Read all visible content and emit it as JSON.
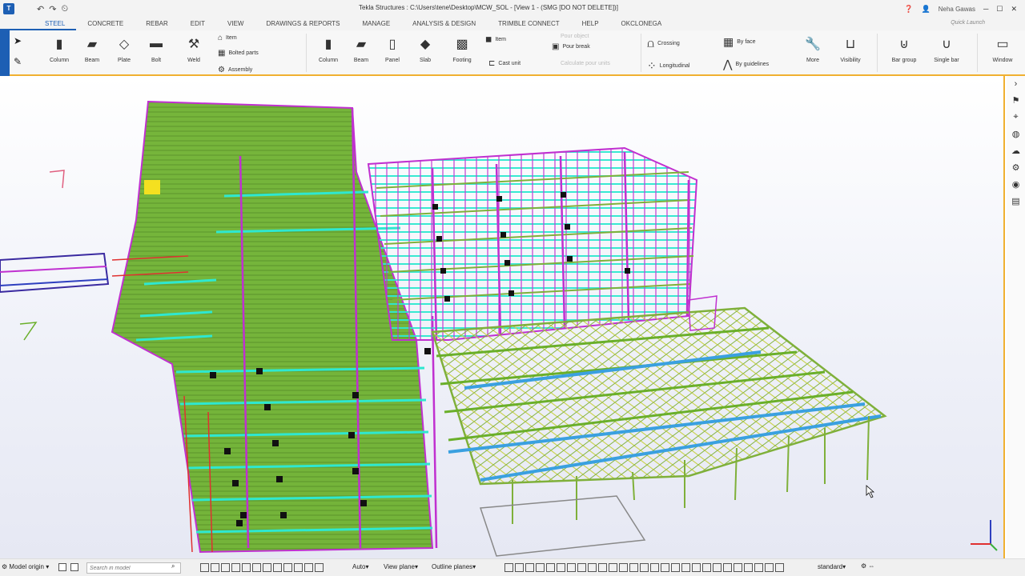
{
  "window": {
    "title": "Tekla Structures : C:\\Users\\tene\\Desktop\\MCW_SOL  - [View 1 - (SMG [DO NOT DELETE])]",
    "user": "Neha Gawas",
    "icons": [
      "undo-icon",
      "redo-icon",
      "clock-icon",
      "help-icon",
      "user-icon",
      "minimize-icon",
      "maximize-icon",
      "close-icon"
    ]
  },
  "tabs": [
    "STEEL",
    "CONCRETE",
    "REBAR",
    "EDIT",
    "VIEW",
    "DRAWINGS & REPORTS",
    "MANAGE",
    "ANALYSIS & DESIGN",
    "TRIMBLE CONNECT",
    "HELP",
    "OKCLONEGA"
  ],
  "active_tab": "STEEL",
  "quick_launch": "Quick Launch",
  "ribbon": {
    "steel": {
      "column": "Column",
      "beam": "Beam",
      "plate": "Plate",
      "bolt": "Bolt",
      "weld": "Weld"
    },
    "parts": {
      "item": "Item",
      "bolted_parts": "Bolted parts",
      "assembly": "Assembly"
    },
    "concrete": {
      "column": "Column",
      "beam": "Beam",
      "panel": "Panel",
      "slab": "Slab",
      "footing": "Footing",
      "item": "Item",
      "pour_break": "Pour break",
      "cast_unit": "Cast unit"
    },
    "disabled": {
      "a": "Pour object",
      "b": "Calculate pour units"
    },
    "rebar": {
      "crossing": "Crossing",
      "longitudinal": "Longitudinal",
      "by_face": "By face",
      "by_guidelines": "By guidelines"
    },
    "misc": {
      "more": "More",
      "visibility": "Visibility",
      "bar_group": "Bar group",
      "single_bar": "Single bar",
      "window": "Window"
    }
  },
  "status": {
    "model_origin": "Model origin",
    "search_placeholder": "Search in model",
    "auto": "Auto",
    "view_plane": "View plane",
    "outline_planes": "Outline planes",
    "standard": "standard"
  },
  "colors": {
    "accent": "#1d5fb4",
    "highlight": "#f0b030",
    "green": "#6aaf2a",
    "cyan": "#2ee8d0",
    "magenta": "#c030d0",
    "yellow": "#d8e040"
  }
}
